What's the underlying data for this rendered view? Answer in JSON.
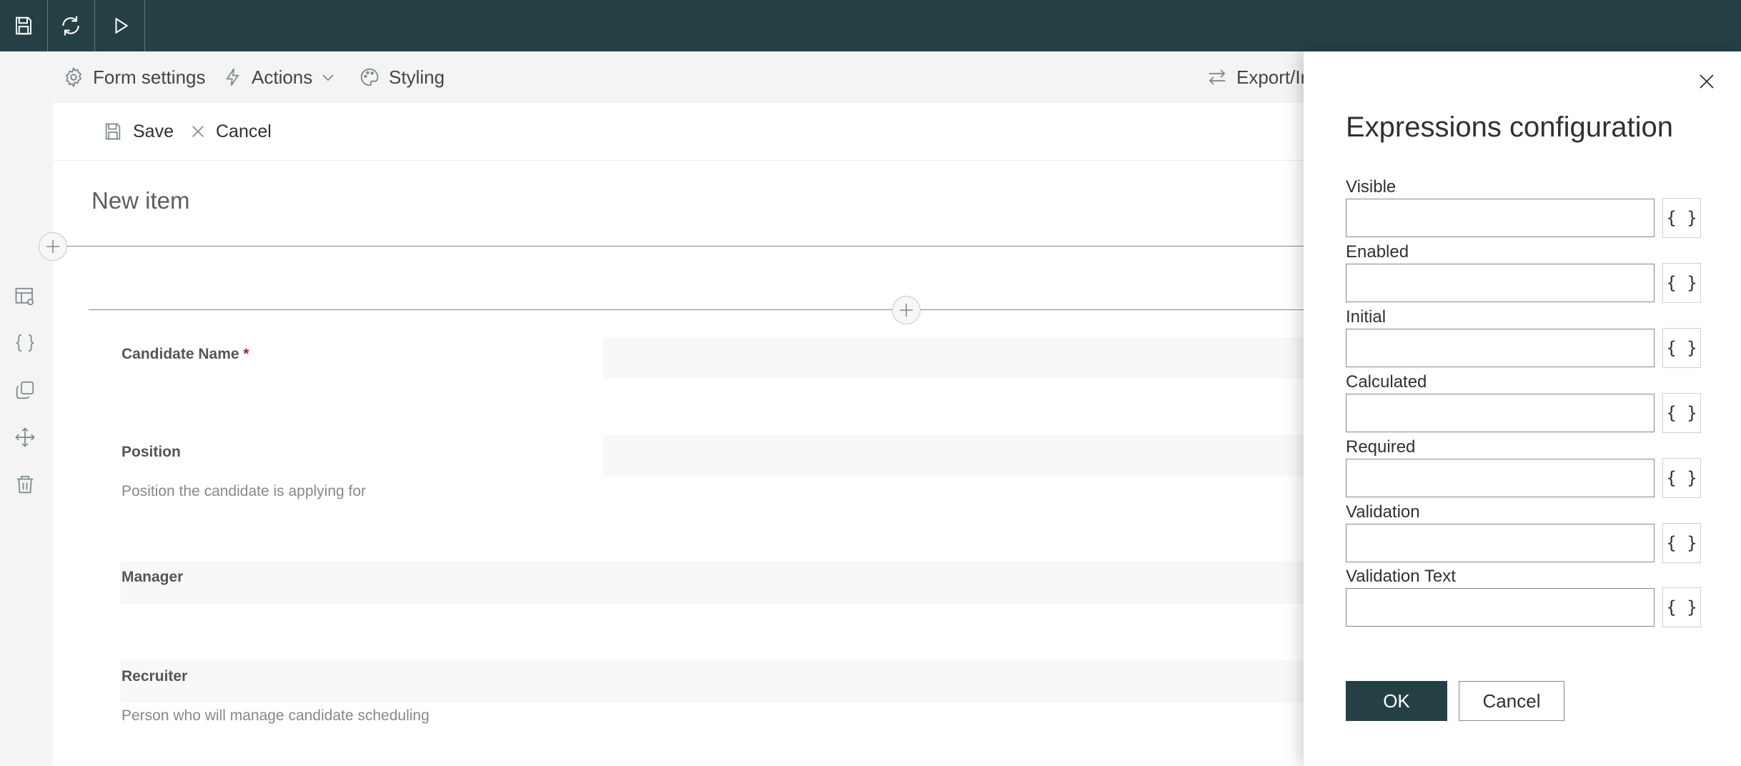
{
  "toolbar": {
    "save_icon": "save-icon",
    "refresh_icon": "refresh-icon",
    "run_icon": "play-icon"
  },
  "command_bar": {
    "form_settings": "Form settings",
    "actions": "Actions",
    "styling": "Styling",
    "export_import": "Export/Im"
  },
  "rail": {
    "icons": [
      "table-settings-icon",
      "braces-icon",
      "copy-icon",
      "move-icon",
      "delete-icon"
    ]
  },
  "form": {
    "save_label": "Save",
    "cancel_label": "Cancel",
    "title": "New item",
    "fields": [
      {
        "label": "Candidate Name",
        "required_marker": "*",
        "description": ""
      },
      {
        "label": "Position",
        "description": "Position the candidate is applying for"
      },
      {
        "label": "Manager",
        "description": ""
      },
      {
        "label": "Recruiter",
        "description": "Person who will manage candidate scheduling"
      }
    ]
  },
  "panel": {
    "title": "Expressions configuration",
    "rows": [
      {
        "label": "Visible",
        "value": "",
        "button": "{ }"
      },
      {
        "label": "Enabled",
        "value": "",
        "button": "{ }"
      },
      {
        "label": "Initial",
        "value": "",
        "button": "{ }"
      },
      {
        "label": "Calculated",
        "value": "",
        "button": "{ }"
      },
      {
        "label": "Required",
        "value": "",
        "button": "{ }"
      },
      {
        "label": "Validation",
        "value": "",
        "button": "{ }"
      },
      {
        "label": "Validation Text",
        "value": "",
        "button": "{ }"
      }
    ],
    "ok_label": "OK",
    "cancel_label": "Cancel"
  },
  "colors": {
    "brand_dark": "#254045",
    "required": "#a4262c"
  }
}
